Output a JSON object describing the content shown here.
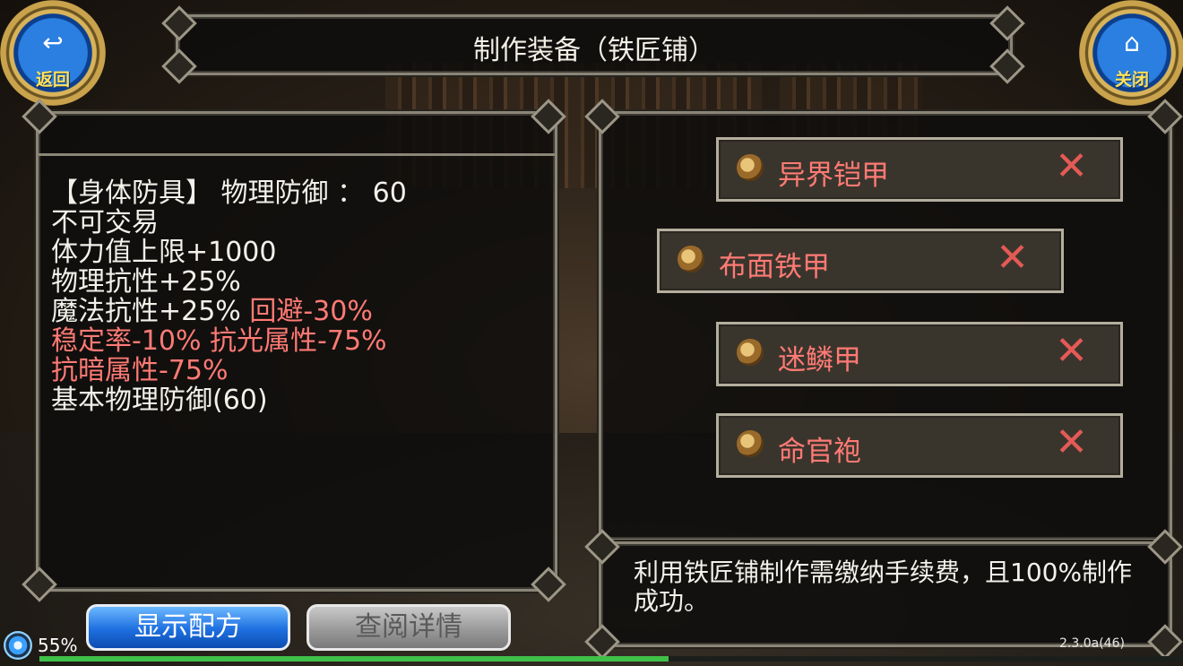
{
  "window": {
    "title": "制作装备（铁匠铺）"
  },
  "nav": {
    "back_label": "返回",
    "close_label": "关闭",
    "back_icon": "back-arrow-icon",
    "close_icon": "home-icon"
  },
  "item": {
    "stats": [
      {
        "text": "【身体防具】 物理防御 ： 60",
        "color": "white"
      },
      {
        "text": "不可交易",
        "color": "white"
      },
      {
        "text": "体力值上限+1000",
        "color": "white"
      },
      {
        "text": "物理抗性+25%",
        "color": "white"
      },
      {
        "parts": [
          {
            "text": "魔法抗性+25% ",
            "color": "white"
          },
          {
            "text": "回避-30%",
            "color": "red"
          }
        ]
      },
      {
        "text": "稳定率-10% 抗光属性-75%",
        "color": "red"
      },
      {
        "text": "抗暗属性-75%",
        "color": "red"
      },
      {
        "text": "基本物理防御(60)",
        "color": "white"
      }
    ]
  },
  "recipes": [
    {
      "name": "异界铠甲",
      "icon": "armor-icon",
      "status_icon": "x-icon"
    },
    {
      "name": "布面铁甲",
      "icon": "armor-icon",
      "status_icon": "x-icon",
      "selected": true
    },
    {
      "name": "迷鳞甲",
      "icon": "armor-icon",
      "status_icon": "x-icon"
    },
    {
      "name": "命官袍",
      "icon": "armor-icon",
      "status_icon": "x-icon"
    }
  ],
  "description": "利用铁匠铺制作需缴纳手续费，且100%制作成功。",
  "buttons": {
    "show_recipe": "显示配方",
    "view_detail": "查阅详情"
  },
  "status": {
    "battery_percent": "55%",
    "progress": 0.55,
    "version": "2.3.0a(46)"
  },
  "colors": {
    "accent_blue": "#1d6fe0",
    "warning_red": "#ff7a75",
    "gold": "#d8b35a"
  }
}
